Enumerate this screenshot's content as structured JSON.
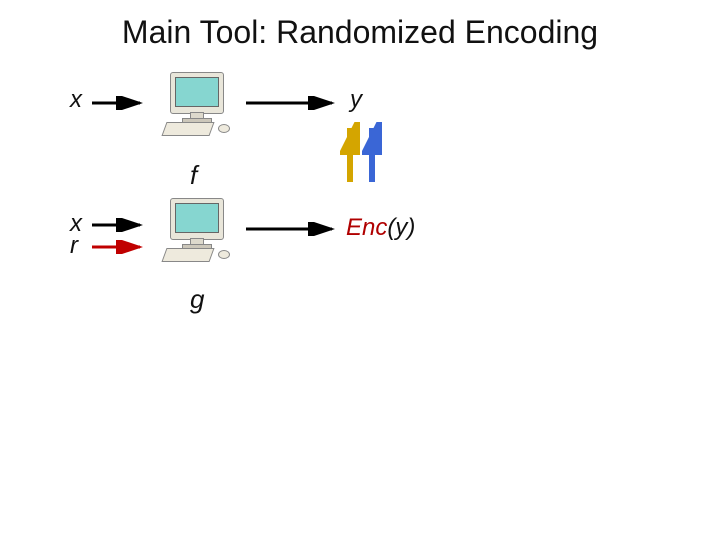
{
  "title": "Main Tool: Randomized Encoding",
  "top": {
    "input_label": "x",
    "output_label": "y",
    "function_label": "f"
  },
  "bottom": {
    "input1_label": "x",
    "input2_label": "r",
    "output_prefix": "Enc",
    "output_arg": "(y)",
    "function_label": "g"
  },
  "colors": {
    "arrow_black": "#000000",
    "arrow_red": "#c00000",
    "arrow_gold": "#d4a500",
    "arrow_blue": "#3a66d6"
  }
}
